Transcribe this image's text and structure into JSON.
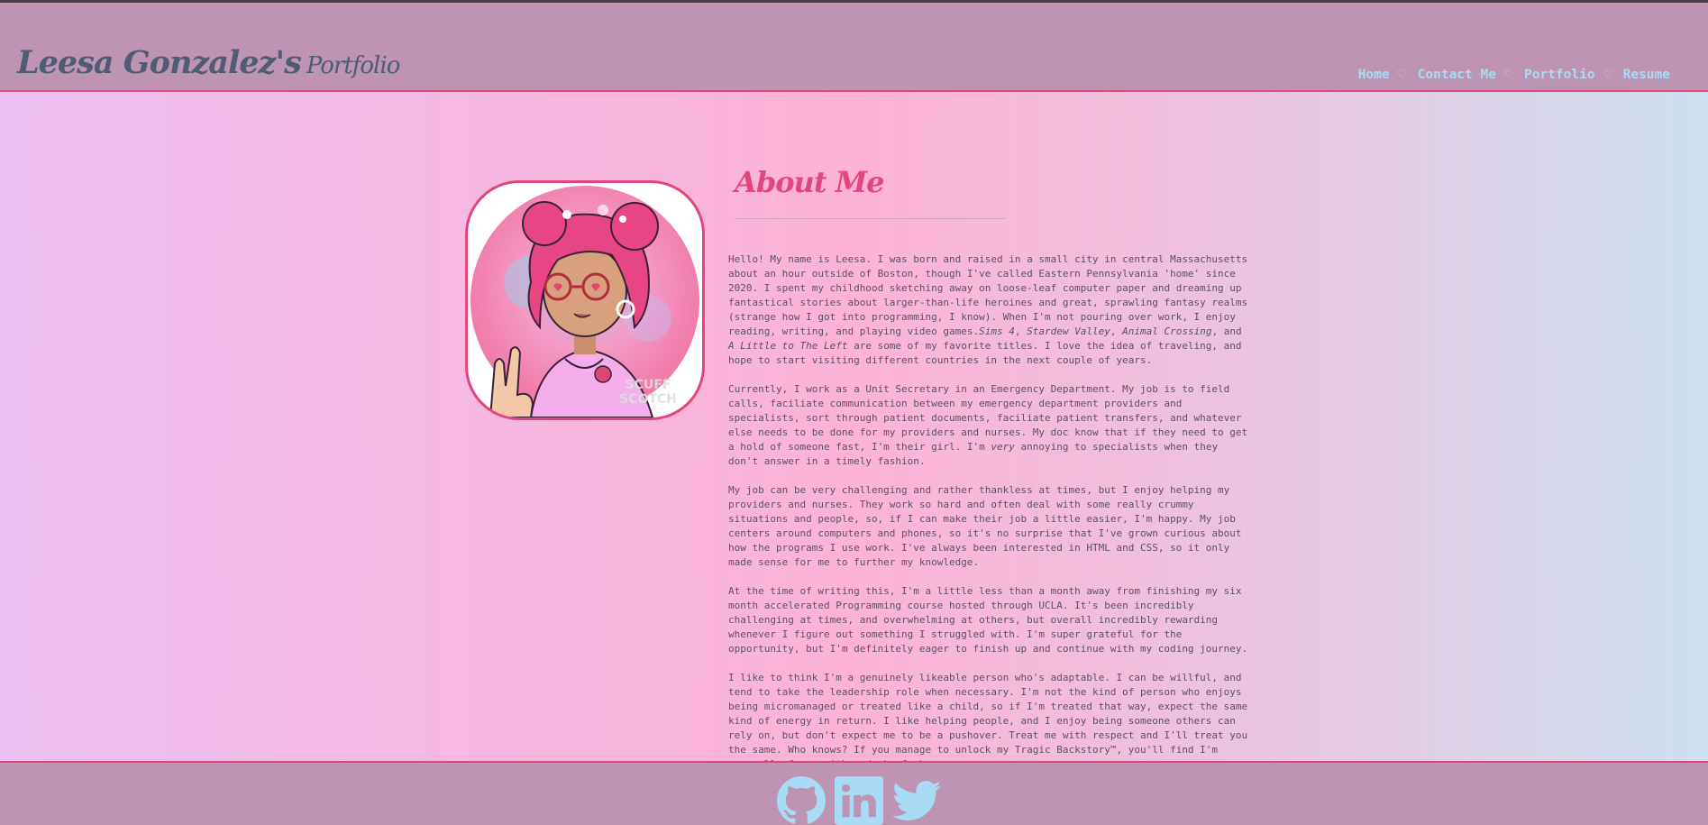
{
  "header": {
    "brand_name": "Leesa Gonzalez's",
    "brand_sub": "Portfolio",
    "nav": [
      {
        "label": "Home"
      },
      {
        "label": "Contact Me"
      },
      {
        "label": "Portfolio"
      },
      {
        "label": "Resume"
      }
    ],
    "separator_icon": "heart-icon"
  },
  "colors": {
    "header_bg": "#bd94b1",
    "accent": "#e0457e",
    "nav_link": "#a8dcf5",
    "brand": "#4e5c74",
    "body_text": "#5a5066",
    "footer_icon": "#a8dcf5"
  },
  "about": {
    "title": "About Me",
    "avatar_watermark": "SCUFF SCOTCH",
    "paragraphs": [
      {
        "p1a": "Hello! My name is Leesa. I was born and raised in a small city in central Massachusetts about an hour outside of Boston, though I've called Eastern Pennsylvania 'home' since 2020. I spent my childhood sketching away on loose-leaf computer paper and dreaming up fantastical stories about larger-than-life heroines and great, sprawling fantasy realms (strange how I got into programming, I know). When I'm not pouring over work, I enjoy reading, writing, and playing video games.",
        "title1": "Sims 4",
        "title2": "Stardew Valley",
        "title3": "Animal Crossing",
        "title4": "A Little to The Left",
        "p1b": " are some of my favorite titles. I love the idea of traveling, and hope to start visiting different countries in the next couple of years."
      },
      {
        "p2a": "Currently, I work as a Unit Secretary in an Emergency Department. My job is to field calls, faciliate communication between my emergency department providers and specialists, sort through patient documents, faciliate patient transfers, and whatever else needs to be done for my providers and nurses. My doc know that if they need to get a hold of someone fast, I'm their girl. I'm ",
        "p2em": "very",
        "p2b": " annoying to specialists when they don't answer in a timely fashion."
      },
      {
        "text": "My job can be very challenging and rather thankless at times, but I enjoy helping my providers and nurses. They work so hard and often deal with some really crummy situations and people, so, if I can make their job a little easier, I'm happy. My job centers around computers and phones, so it's no surprise that I've grown curious about how the programs I use work. I've always been interested in HTML and CSS, so it only made sense for me to further my knowledge."
      },
      {
        "text": "At the time of writing this, I'm a little less than a month away from finishing my six month accelerated Programming course hosted through UCLA. It's been incredibly challenging at times, and overwhelming at others, but overall incredibly rewarding whenever I figure out something I struggled with. I'm super grateful for the opportunity, but I'm definitely eager to finish up and continue with my coding journey."
      },
      {
        "text": "I like to think I'm a genuinely likeable person who's adaptable. I can be willful, and tend to take the leadership role when necessary. I'm not the kind of person who enjoys being micromanaged or treated like a child, so if I'm treated that way, expect the same kind of energy in return. I like helping people, and I enjoy being someone others can rely on, but don't expect me to be a pushover. Treat me with respect and I'll treat you the same. Who knows? If you manage to unlock my Tragic Backstory™, you'll find I'm generally funny with a dash of chaos."
      }
    ]
  },
  "footer": {
    "social_icons": [
      "github-icon",
      "linkedin-icon",
      "twitter-icon"
    ]
  }
}
